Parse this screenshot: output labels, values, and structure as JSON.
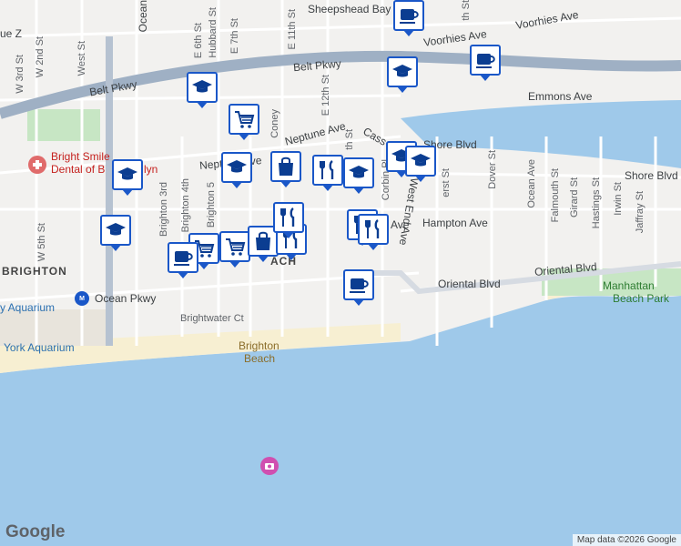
{
  "map": {
    "neighborhoods": [
      "BRIGHTON"
    ],
    "roads": {
      "belt_pkwy": "Belt Pkwy",
      "voorhies_ave": "Voorhies Ave",
      "emmons_ave": "Emmons Ave",
      "neptune_ave": "Neptune Ave",
      "cass_pl": "Cass",
      "shore_blvd": "Shore Blvd",
      "shore_blvd_east": "Shore Blvd",
      "oriental_blvd_left": "Oriental Blvd",
      "oriental_blvd_right": "Oriental Blvd",
      "ocean_pkwy": "Ocean Pkwy",
      "west_end_ave": "West End Ave",
      "hampton_ave": "Hampton Ave",
      "ave_fragment": "Ave",
      "brightwater_ct": "Brightwater Ct",
      "coney": "Coney",
      "e_11th": "E 11th St",
      "e_12th": "E 12th St",
      "e_7th": "E 7th St",
      "e_6th": "E 6th St",
      "hubbard": "Hubbard St",
      "ocean": "Ocean",
      "w_2nd": "W 2nd St",
      "w_3rd": "W 3rd St",
      "west_st": "West St",
      "w_5th": "W 5th St",
      "brighton_3rd": "Brighton 3rd",
      "brighton_4th": "Brighton 4th",
      "brighton_5": "Brighton 5",
      "corbin": "Corbin Pl",
      "dover": "Dover St",
      "ocean_ave": "Ocean Ave",
      "falmouth": "Falmouth St",
      "girard": "Girard St",
      "hastings": "Hastings St",
      "irwin": "Irwin St",
      "jaffray": "Jaffray St",
      "amherst": "erst St",
      "th_st": "th St",
      "th_st2": "th St",
      "ue_z": "ue Z"
    },
    "places": {
      "sheepshead_bay": "Sheepshead Bay",
      "bright_smile_line1": "Bright Smile",
      "bright_smile_line2": "Dental of B",
      "bright_smile_line2b": "lyn",
      "york_aquarium": "York Aquarium",
      "aquarium_short": "y Aquarium",
      "brighton_beach_1": "Brighton",
      "brighton_beach_2": "Beach",
      "manhattan_beach_park_1": "Manhattan",
      "manhattan_beach_park_2": "Beach Park",
      "station_label": "ACH"
    },
    "colors": {
      "water": "#9fc9ea",
      "land": "#f2f1ef",
      "highway": "#9fb0c4",
      "park": "#c7e6c4",
      "beach": "#f7efd2",
      "marker_border": "#1a57c8"
    },
    "markers": [
      {
        "icon": "school"
      },
      {
        "icon": "school"
      },
      {
        "icon": "school"
      },
      {
        "icon": "school"
      },
      {
        "icon": "school"
      },
      {
        "icon": "school"
      },
      {
        "icon": "school"
      },
      {
        "icon": "school"
      },
      {
        "icon": "shopping-cart"
      },
      {
        "icon": "shopping-cart"
      },
      {
        "icon": "shopping-cart"
      },
      {
        "icon": "shopping-bag"
      },
      {
        "icon": "shopping-bag"
      },
      {
        "icon": "restaurant"
      },
      {
        "icon": "restaurant"
      },
      {
        "icon": "restaurant"
      },
      {
        "icon": "restaurant"
      },
      {
        "icon": "restaurant"
      },
      {
        "icon": "coffee"
      },
      {
        "icon": "coffee"
      },
      {
        "icon": "coffee"
      },
      {
        "icon": "coffee"
      }
    ],
    "attribution": "Map data ©2026 Google",
    "logo": "Google"
  }
}
